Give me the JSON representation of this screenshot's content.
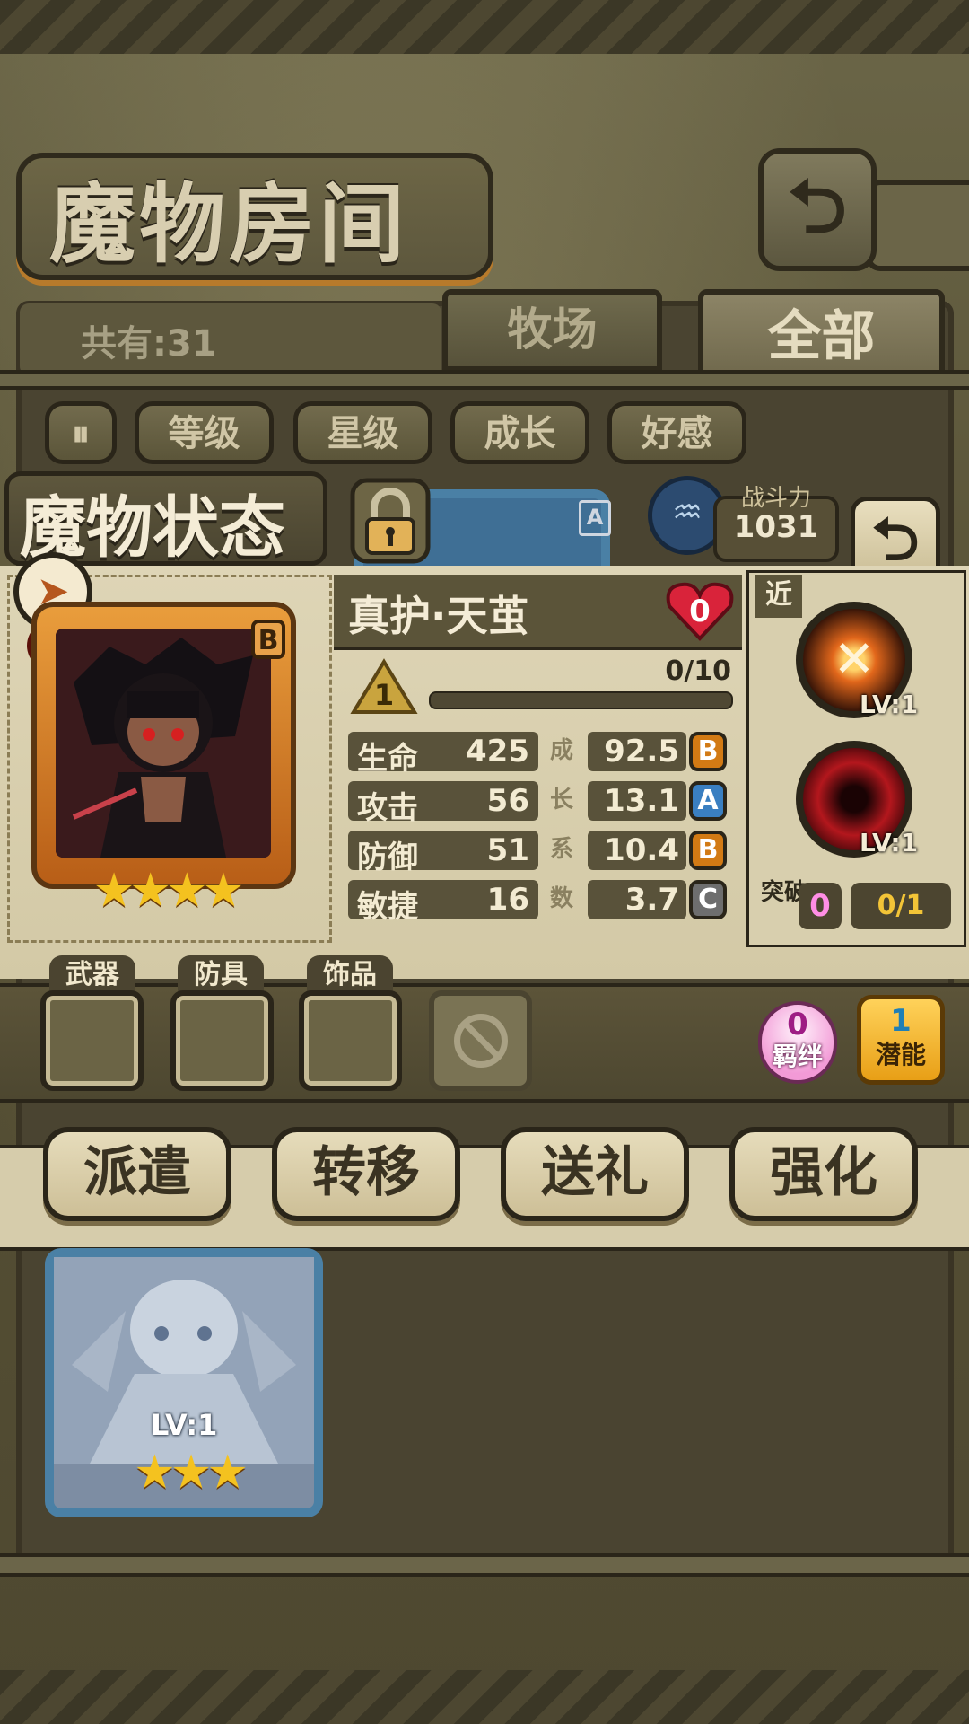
{
  "header": {
    "title": "魔物房间",
    "back_icon": "return-arrow-icon"
  },
  "collection": {
    "count_text": "共有:31",
    "tabs": [
      {
        "label": "牧场",
        "active": false
      },
      {
        "label": "全部",
        "active": true
      }
    ],
    "sort_buttons": [
      "等级",
      "星级",
      "成长",
      "好感"
    ]
  },
  "status": {
    "panel_title": "魔物状态",
    "power_label": "战斗力",
    "power_value": "1031",
    "monster": {
      "name": "真护·天茧",
      "rarity": "B",
      "stars": 4,
      "affection": "0",
      "level": "1",
      "exp_text": "0/10",
      "exp_fraction": 0.0,
      "growth_label": [
        "成",
        "长",
        "系",
        "数"
      ],
      "stats": [
        {
          "label": "生命",
          "value": "425",
          "growth": "92.5",
          "grade": "B"
        },
        {
          "label": "攻击",
          "value": "56",
          "growth": "13.1",
          "grade": "A"
        },
        {
          "label": "防御",
          "value": "51",
          "growth": "10.4",
          "grade": "B"
        },
        {
          "label": "敏捷",
          "value": "16",
          "growth": "3.7",
          "grade": "C"
        }
      ]
    },
    "range_tag": "近",
    "skills": [
      {
        "icon": "slash-skill-icon",
        "level": "LV:1"
      },
      {
        "icon": "dark-orb-skill-icon",
        "level": "LV:1"
      }
    ],
    "breakthrough": {
      "label": "突破",
      "count": "0",
      "progress": "0/1"
    }
  },
  "equipment": {
    "slots": [
      "武器",
      "防具",
      "饰品"
    ],
    "bond": {
      "value": "0",
      "label": "羁绊"
    },
    "potential": {
      "value": "1",
      "label": "潜能"
    }
  },
  "actions": [
    "派遣",
    "转移",
    "送礼",
    "强化"
  ],
  "list_card": {
    "level": "LV:1",
    "stars": 3
  },
  "colors": {
    "parchment": "#d8cfae",
    "dark_panel": "#59523a",
    "grade_a": "#3a7fc1",
    "grade_b": "#d27a14",
    "grade_c": "#6e6e6e",
    "card_orange": "#e99d3c",
    "card_blue": "#4a80a5"
  }
}
